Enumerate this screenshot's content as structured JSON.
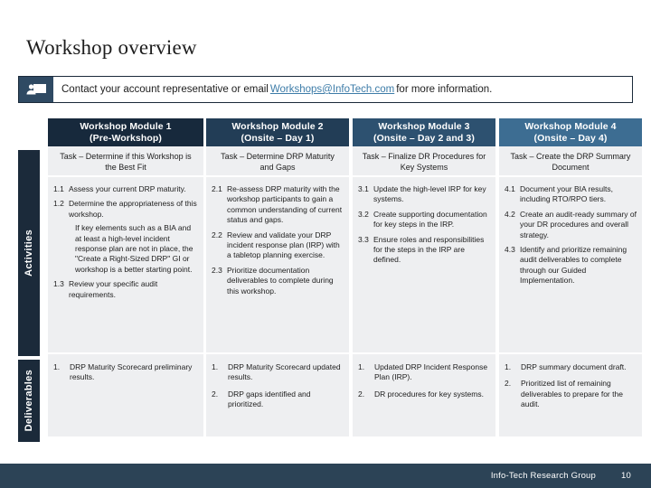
{
  "slide": {
    "title": "Workshop overview"
  },
  "contact_banner": {
    "icon": "contact-card-icon",
    "text_before": "Contact your account representative or email",
    "email": "Workshops@InfoTech.com",
    "text_after": "for more information."
  },
  "matrix": {
    "row_labels": {
      "activities": "Activities",
      "deliverables": "Deliverables"
    },
    "columns": [
      {
        "header_line1": "Workshop Module 1",
        "header_line2": "(Pre-Workshop)",
        "header_color": "#17293c",
        "task": "Task – Determine if this Workshop is the Best Fit",
        "activities": [
          {
            "num": "1.1",
            "text": "Assess your current DRP maturity."
          },
          {
            "num": "1.2",
            "text": "Determine the appropriateness of this workshop."
          },
          {
            "num": "",
            "text": "If key elements such as a BIA and at least a high-level incident response plan are not in place, the \"Create a Right-Sized DRP\" GI or workshop is a better starting point."
          },
          {
            "num": "1.3",
            "text": "Review your specific audit requirements."
          }
        ],
        "deliverables": [
          {
            "num": "1.",
            "text": "DRP Maturity Scorecard preliminary results."
          }
        ]
      },
      {
        "header_line1": "Workshop Module 2",
        "header_line2": "(Onsite – Day 1)",
        "header_color": "#1d3established",
        "task": "Task – Determine DRP Maturity and Gaps",
        "activities": [
          {
            "num": "2.1",
            "text": "Re-assess DRP maturity with the workshop participants to gain a common understanding of current status and gaps."
          },
          {
            "num": "2.2",
            "text": "Review and validate your DRP incident response plan (IRP) with a tabletop planning exercise."
          },
          {
            "num": "2.3",
            "text": "Prioritize documentation deliverables to complete during this workshop."
          }
        ],
        "deliverables": [
          {
            "num": "1.",
            "text": "DRP Maturity Scorecard updated results."
          },
          {
            "num": "2.",
            "text": "DRP gaps identified and prioritized."
          }
        ]
      },
      {
        "header_line1": "Workshop Module 3",
        "header_line2": "(Onsite – Day 2 and 3)",
        "header_color": "#2d5170",
        "task": "Task – Finalize DR Procedures for Key Systems",
        "activities": [
          {
            "num": "3.1",
            "text": "Update the high-level IRP for key systems."
          },
          {
            "num": "3.2",
            "text": "Create supporting documentation for key steps in the IRP."
          },
          {
            "num": "3.3",
            "text": "Ensure roles and responsibilities for the steps in the IRP are defined."
          }
        ],
        "deliverables": [
          {
            "num": "1.",
            "text": "Updated DRP Incident Response Plan (IRP)."
          },
          {
            "num": "2.",
            "text": "DR procedures for key systems."
          }
        ]
      },
      {
        "header_line1": "Workshop Module 4",
        "header_line2": "(Onsite – Day 4)",
        "header_color": "#3d6d92",
        "task": "Task – Create the DRP Summary Document",
        "activities": [
          {
            "num": "4.1",
            "text": "Document your BIA results, including RTO/RPO tiers."
          },
          {
            "num": "4.2",
            "text": "Create an audit-ready summary of your DR procedures and overall strategy."
          },
          {
            "num": "4.3",
            "text": "Identify and prioritize remaining audit deliverables to complete through our Guided Implementation."
          }
        ],
        "deliverables": [
          {
            "num": "1.",
            "text": "DRP summary document draft."
          },
          {
            "num": "2.",
            "text": "Prioritized list of remaining deliverables to prepare for the audit."
          }
        ]
      }
    ]
  },
  "footer": {
    "brand": "Info-Tech Research Group",
    "page": "10",
    "background": "#2c4356"
  }
}
